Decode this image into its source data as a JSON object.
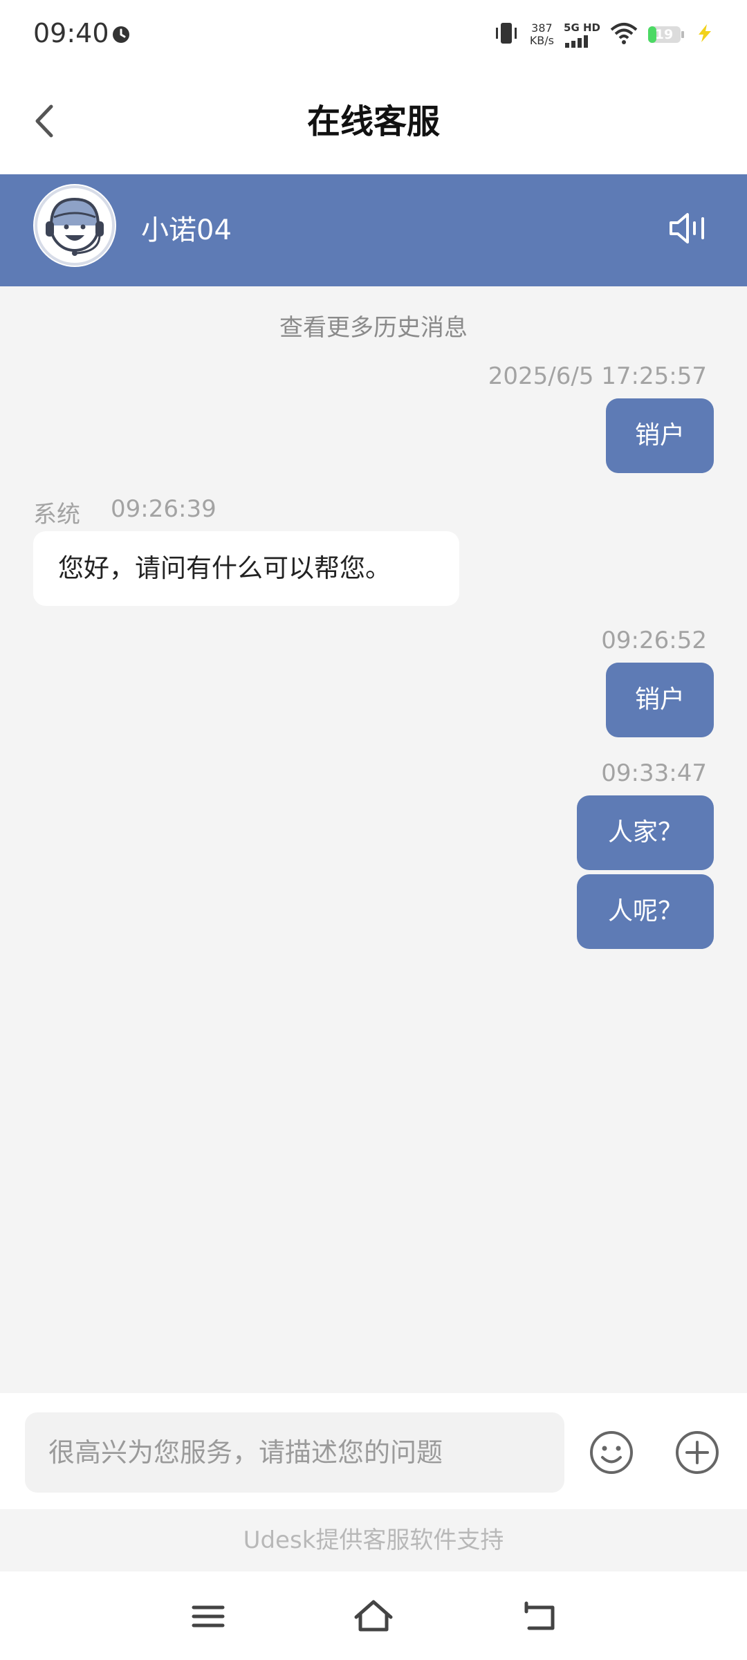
{
  "status_bar": {
    "time": "09:40",
    "net_speed_value": "387",
    "net_speed_unit": "KB/s",
    "network_type": "5G HD",
    "battery_level": "19"
  },
  "header": {
    "title": "在线客服"
  },
  "agent": {
    "name": "小诺04"
  },
  "chat": {
    "history_link": "查看更多历史消息",
    "messages": [
      {
        "time": "2025/6/5 17:25:57",
        "text": "销户"
      },
      {
        "sender": "系统",
        "time": "09:26:39",
        "text": "您好，请问有什么可以帮您。"
      },
      {
        "time": "09:26:52",
        "text": "销户"
      },
      {
        "time": "09:33:47",
        "text": "人家？"
      },
      {
        "text": "人呢？"
      }
    ]
  },
  "input": {
    "placeholder": "很高兴为您服务，请描述您的问题"
  },
  "footer": {
    "text": "Udesk提供客服软件支持"
  },
  "colors": {
    "accent": "#5e7bb5",
    "background": "#f4f4f4"
  }
}
